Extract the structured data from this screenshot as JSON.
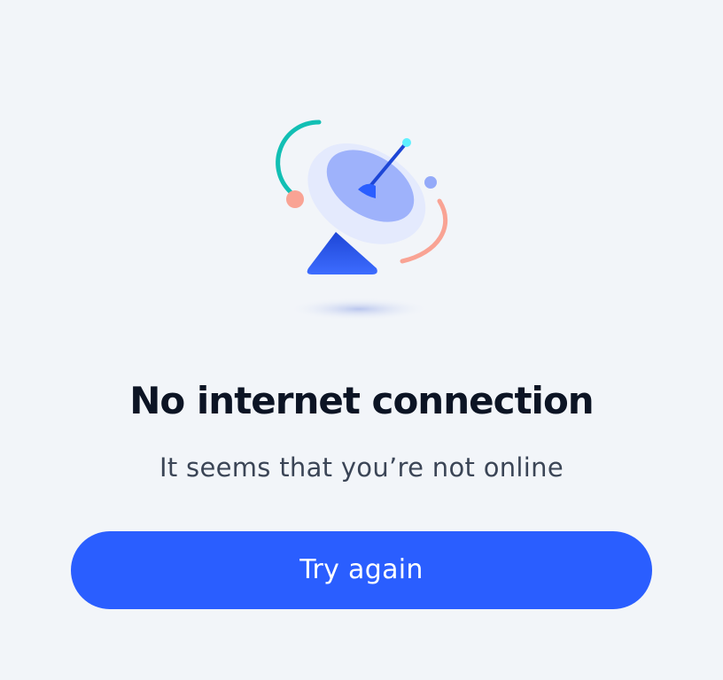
{
  "empty_state": {
    "illustration": "satellite-dish-icon",
    "title": "No internet connection",
    "subtitle": "It seems that you’re not online",
    "button_label": "Try again"
  },
  "colors": {
    "background": "#f2f5f9",
    "title": "#0c1424",
    "subtitle": "#3b4556",
    "button": "#2a5eff",
    "button_text": "#ffffff",
    "accent_teal": "#12bfb4",
    "accent_coral": "#f9a394",
    "dish_blue": "#2a5eff"
  }
}
